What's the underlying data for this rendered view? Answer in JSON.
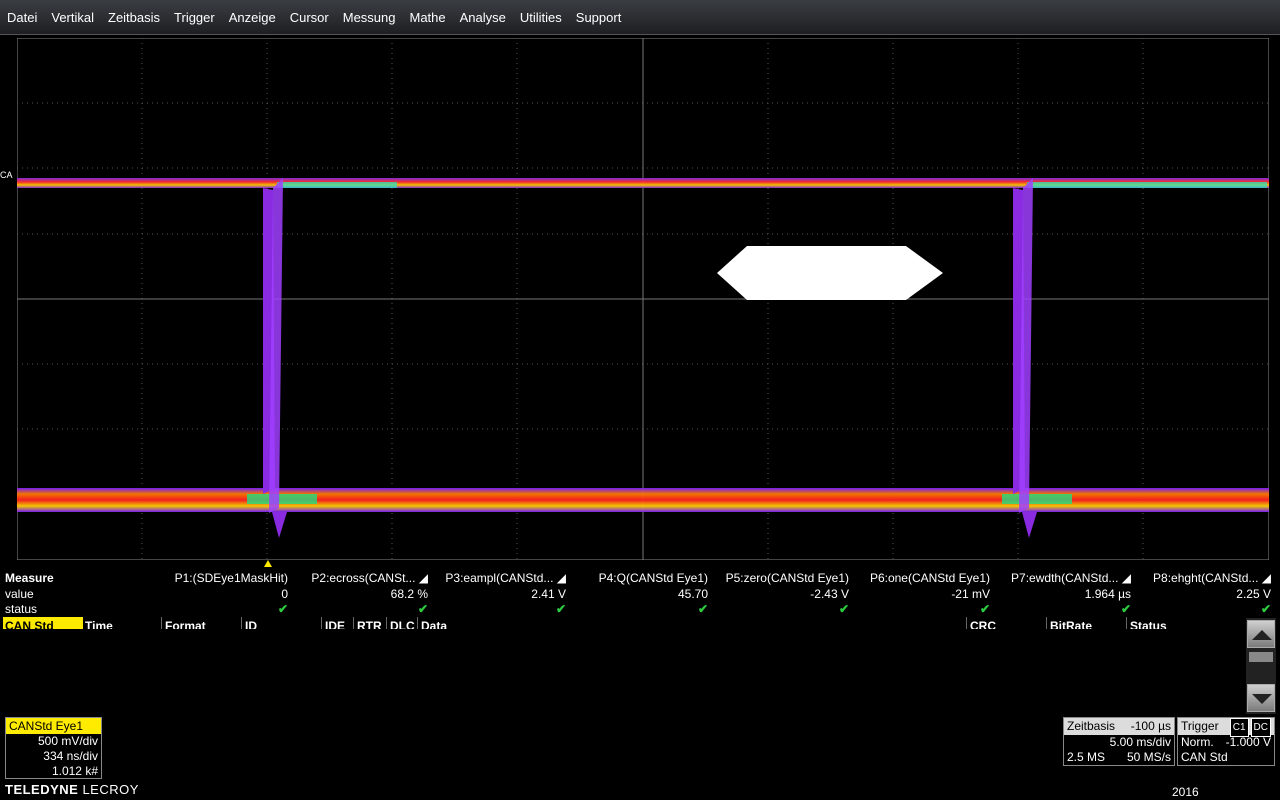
{
  "menu": [
    "Datei",
    "Vertikal",
    "Zeitbasis",
    "Trigger",
    "Anzeige",
    "Cursor",
    "Messung",
    "Mathe",
    "Analyse",
    "Utilities",
    "Support"
  ],
  "channel_marker": "CA",
  "measure": {
    "title": "Measure",
    "row_value": "value",
    "row_status": "status",
    "params": [
      {
        "name": "P1:(SDEye1MaskHit)",
        "value": "0"
      },
      {
        "name": "P2:ecross(CANSt... ◢",
        "value": "68.2 %"
      },
      {
        "name": "P3:eampl(CANStd... ◢",
        "value": "2.41 V"
      },
      {
        "name": "P4:Q(CANStd Eye1)",
        "value": "45.70"
      },
      {
        "name": "P5:zero(CANStd Eye1)",
        "value": "-2.43 V"
      },
      {
        "name": "P6:one(CANStd Eye1)",
        "value": "-21 mV"
      },
      {
        "name": "P7:ewdth(CANStd... ◢",
        "value": "1.964 µs"
      },
      {
        "name": "P8:ehght(CANStd... ◢",
        "value": "2.25 V"
      }
    ],
    "status_mark": "✔"
  },
  "decode_table": {
    "columns": [
      "CAN Std",
      "Time",
      "Format",
      "ID",
      "IDE",
      "RTR",
      "DLC",
      "Data",
      "CRC",
      "BitRate",
      "Status"
    ]
  },
  "channel_desc": {
    "title": "CANStd Eye1",
    "vdiv": "500 mV/div",
    "tdiv": "334 ns/div",
    "count": "1.012 k#"
  },
  "brand": {
    "bold": "TELEDYNE",
    "light": " LECROY"
  },
  "timebase": {
    "label": "Zeitbasis",
    "delay": "-100 µs",
    "tdiv": "5.00 ms/div",
    "points": "2.5 MS",
    "rate": "50 MS/s"
  },
  "trigger": {
    "label": "Trigger",
    "source": "C1",
    "coupling": "DC",
    "mode": "Norm.",
    "level": "-1.000 V",
    "type": "CAN Std"
  },
  "year": "2016",
  "colors": {
    "accent": "#ffeb00",
    "check": "#2ecc40",
    "trace_purple": "#8a2be2"
  }
}
